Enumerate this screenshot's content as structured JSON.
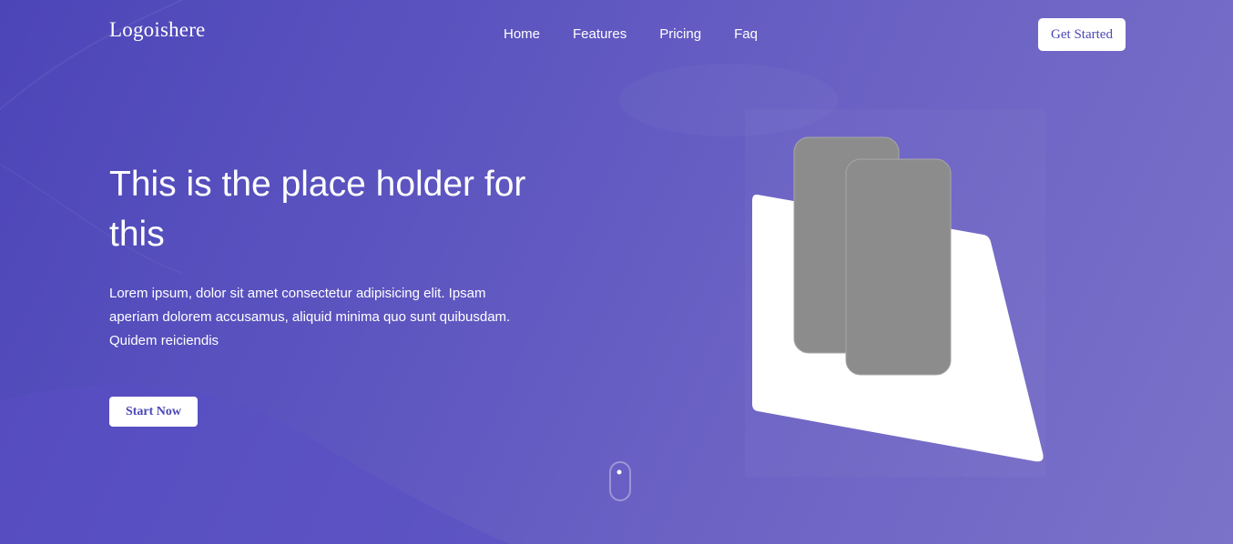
{
  "header": {
    "logo": "Logoishere",
    "nav": [
      {
        "label": "Home"
      },
      {
        "label": "Features"
      },
      {
        "label": "Pricing"
      },
      {
        "label": "Faq"
      }
    ],
    "cta_label": "Get Started"
  },
  "hero": {
    "title": "This is the place holder for this",
    "description": "Lorem ipsum, dolor sit amet consectetur adipisicing elit. Ipsam aperiam dolorem accusamus, aliquid minima quo sunt quibusdam. Quidem reiciendis",
    "button_label": "Start Now"
  },
  "illustration": {
    "icon": "phone-mockup-illustration"
  },
  "scroll": {
    "icon": "mouse-scroll-icon"
  },
  "colors": {
    "background_start": "#4c45b8",
    "background_end": "#7b72c9",
    "button_text": "#4a47b6",
    "phone_fill": "#8c8c8c",
    "card_fill": "#ffffff"
  }
}
